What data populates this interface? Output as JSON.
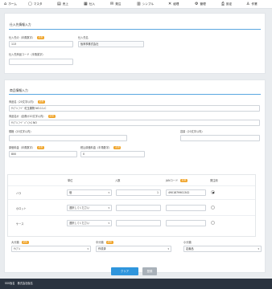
{
  "nav": {
    "items": [
      {
        "icon": "⌂",
        "label": "ホーム"
      },
      {
        "icon": "▢",
        "label": "マスタ"
      },
      {
        "icon": "▤",
        "label": "売上"
      },
      {
        "icon": "▦",
        "label": "仕入"
      },
      {
        "icon": "✉",
        "label": "発注"
      },
      {
        "icon": "▥",
        "label": "シンプル"
      },
      {
        "icon": "✕",
        "label": "経理"
      },
      {
        "icon": "⚙",
        "label": "管理"
      },
      {
        "icon": "⎙",
        "label": "設定"
      },
      {
        "icon": "♙",
        "label": "作業"
      }
    ]
  },
  "supplier": {
    "title": "仕入先情報入力",
    "code_label": "仕入先の（半角数字）",
    "code_value": "113",
    "name_label": "仕入先名",
    "name_value": "仮商事株式会社",
    "item_code_label": "仕入先商品コード（半角英字）",
    "item_code_value": ""
  },
  "product": {
    "title": "商品情報入力",
    "name_label": "商品名（20文字以内）",
    "name_value": "ｻﾝﾌﾟﾙ ﾌｰﾄﾞ 紅玉果物 NO.11-C",
    "kana_label": "商品名ｶﾅ（全角ｶﾅ20文字以内）",
    "kana_value": "ｻﾝﾌﾟﾙ ﾌｰﾄﾞ ﾊﾟﾝﾌｧｽ NO",
    "spec_label": "規格（20文字以内）",
    "spec_value": "",
    "capacity_label": "容量（20文字以内）",
    "capacity_value": "",
    "cost_label": "原価料金（半角数字）",
    "cost_value": "800",
    "tax_cost_label": "税込原価料金（半角数字）",
    "tax_cost_value": "0",
    "required": "必須"
  },
  "table": {
    "headers": [
      "単位",
      "入数",
      "JANコード",
      "発注用"
    ],
    "jan_required": "必須",
    "rows": [
      {
        "label": "バラ",
        "unit": "個",
        "qty": "1",
        "jan": "4901879901342",
        "order": true
      },
      {
        "label": "小ロット",
        "unit": "選択してください",
        "qty": "",
        "jan": "",
        "order": false
      },
      {
        "label": "ケース",
        "unit": "選択してください",
        "qty": "",
        "jan": "",
        "order": false
      }
    ]
  },
  "categories": {
    "large_label": "大分類",
    "large_value": "ｻﾝﾌﾟﾙ",
    "medium_label": "中分類",
    "medium_value": "作成済",
    "small_label": "小分類",
    "small_value": "定番品",
    "required": "必須"
  },
  "buttons": {
    "clear": "クリア",
    "register": "登録"
  },
  "footer": {
    "text": "SSS仮名　株式会社仮名"
  },
  "colors": {
    "accent": "#5aa7e0",
    "primary_button": "#2f95dc",
    "disabled_button": "#a9b1b9",
    "required_badge": "#f0a52c"
  }
}
